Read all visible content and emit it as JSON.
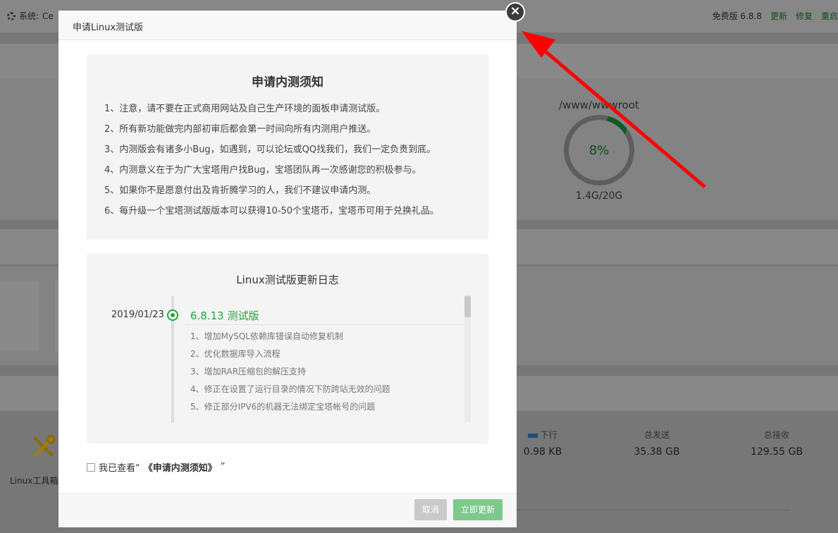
{
  "background": {
    "system_label": "系统:",
    "system_value": "Ce",
    "version": "免费版 6.8.8",
    "links": [
      "更新",
      "修复",
      "重启"
    ],
    "disk": {
      "path": "/www/wwwroot",
      "percent": "8%",
      "size": "1.4G/20G"
    },
    "network": [
      {
        "label": "下行",
        "value": "0.98 KB"
      },
      {
        "label": "总发送",
        "value": "35.38 GB"
      },
      {
        "label": "总接收",
        "value": "129.55 GB"
      }
    ],
    "tool_label": "Linux工具箱"
  },
  "modal": {
    "title": "申请Linux测试版",
    "close_icon": "close-icon",
    "notice": {
      "heading": "申请内测须知",
      "items": [
        "1、注意，请不要在正式商用网站及自己生产环境的面板申请测试版。",
        "2、所有新功能做完内部初审后都会第一时间向所有内测用户推送。",
        "3、内测版会有诸多小Bug，如遇到，可以论坛或QQ找我们，我们一定负责到底。",
        "4、内测意义在于为广大宝塔用户找Bug，宝塔团队再一次感谢您的积极参与。",
        "5、如果你不是愿意付出及肯折腾学习的人，我们不建议申请内测。",
        "6、每升级一个宝塔测试版版本可以获得10-50个宝塔币，宝塔币可用于兑换礼品。"
      ]
    },
    "changelog": {
      "heading": "Linux测试版更新日志",
      "date": "2019/01/23",
      "version": "6.8.13 测试版",
      "items": [
        "1、增加MySQL依赖库错误自动修复机制",
        "2、优化数据库导入流程",
        "3、增加RAR压缩包的解压支持",
        "4、修正在设置了运行目录的情况下防跨站无效的问题",
        "5、修正部分IPV6的机器无法绑定宝塔帐号的问题"
      ]
    },
    "agree_prefix": "我已查看“",
    "agree_link": "《申请内测须知》",
    "agree_suffix": "”",
    "cancel_label": "取消",
    "confirm_label": "立即更新"
  },
  "colors": {
    "accent": "#20a53a",
    "arrow": "#ff0000"
  }
}
